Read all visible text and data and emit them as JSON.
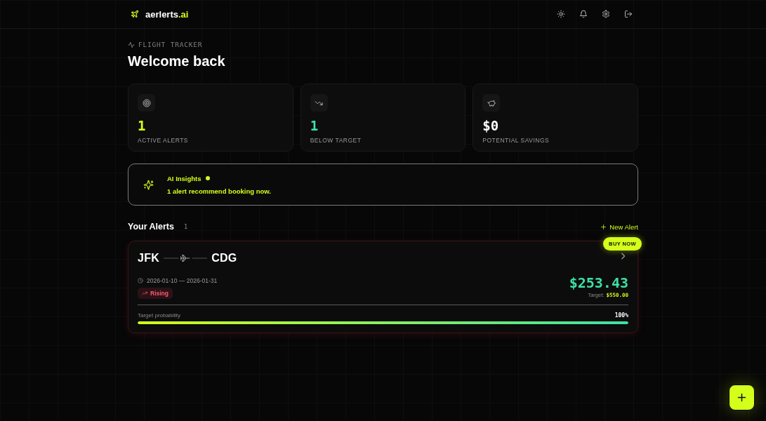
{
  "header": {
    "brand": "aerlerts",
    "brand_suffix": ".ai"
  },
  "page": {
    "eyebrow": "FLIGHT TRACKER",
    "title": "Welcome back"
  },
  "stats": [
    {
      "value": "1",
      "label": "ACTIVE ALERTS",
      "color": "#d4ff1a"
    },
    {
      "value": "1",
      "label": "BELOW TARGET",
      "color": "#3ee0a4"
    },
    {
      "value": "$0",
      "label": "POTENTIAL SAVINGS",
      "color": "#ffffff"
    }
  ],
  "insights": {
    "title": "AI Insights",
    "message": "1 alert recommend booking now."
  },
  "alerts_section": {
    "title": "Your Alerts",
    "count": "1",
    "new_alert": "New Alert"
  },
  "alerts": [
    {
      "origin": "JFK",
      "destination": "CDG",
      "dates": "2026-01-10 — 2026-01-31",
      "trend": {
        "label": "Rising",
        "kind": "rising"
      },
      "price": "$253.43",
      "target_label": "Target:",
      "target_price": "$550.00",
      "badge": "BUY NOW",
      "probability_label": "Target probability",
      "probability": "100%",
      "level": 1
    }
  ]
}
